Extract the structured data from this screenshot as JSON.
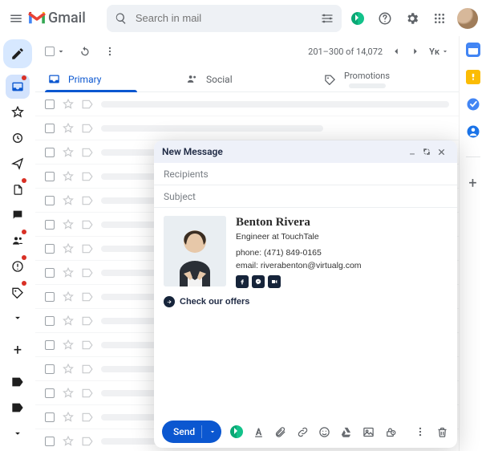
{
  "header": {
    "product": "Gmail",
    "search_placeholder": "Search in mail"
  },
  "toolbar": {
    "page_range": "201–300 of 14,072",
    "lang_toggle": "Yᴋ"
  },
  "tabs": {
    "primary": "Primary",
    "social": "Social",
    "promotions": "Promotions"
  },
  "compose": {
    "title": "New Message",
    "recipients": "Recipients",
    "subject": "Subject",
    "send": "Send"
  },
  "signature": {
    "name": "Benton Rivera",
    "title": "Engineer at TouchTale",
    "phone": "phone: (471) 849-0165",
    "email": "email: riverabenton@virtualg.com",
    "cta": "Check our offers"
  }
}
